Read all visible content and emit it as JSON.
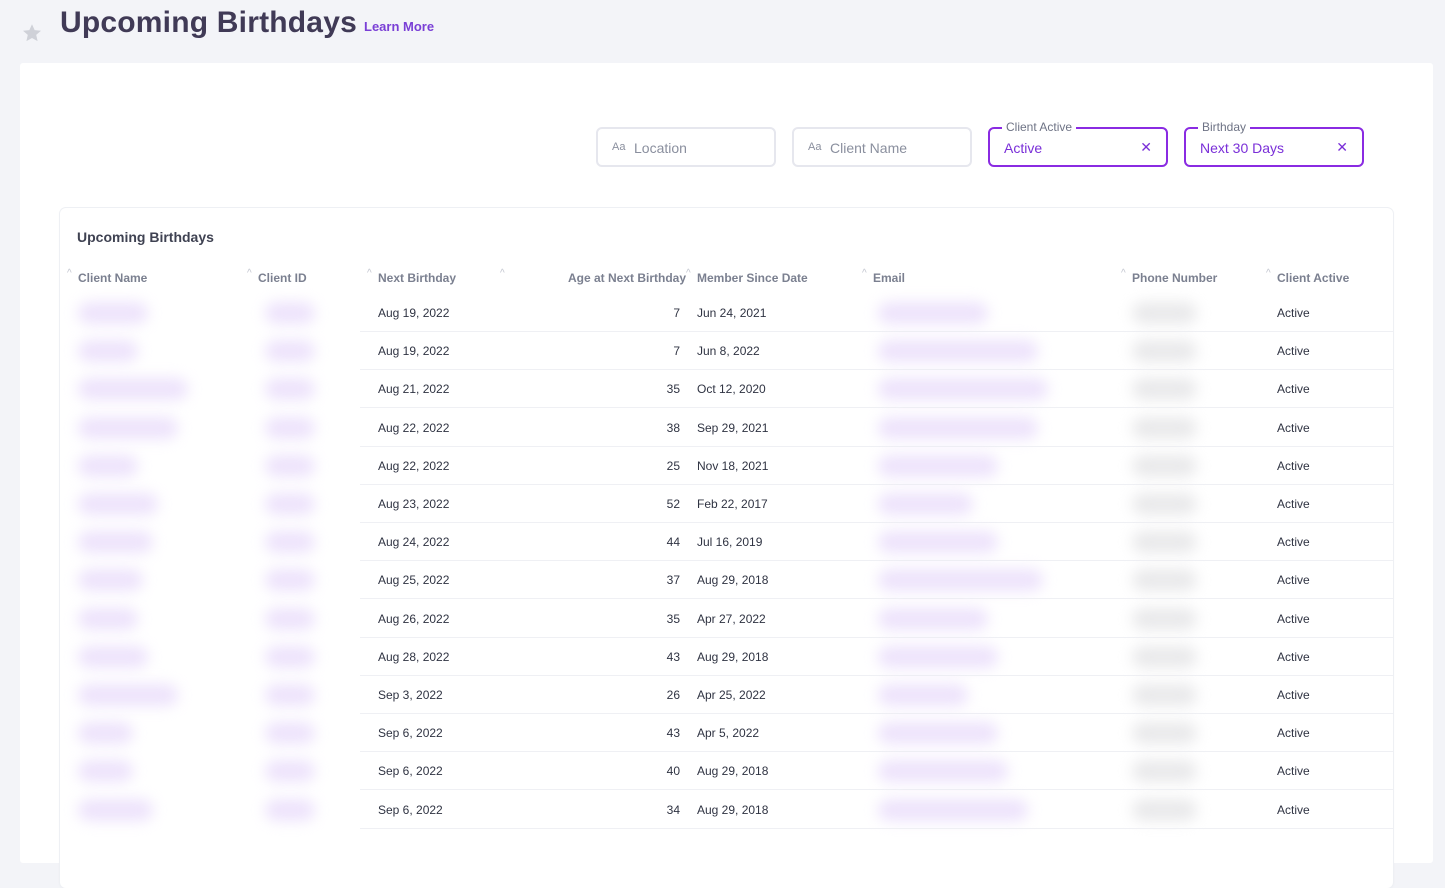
{
  "header": {
    "title": "Upcoming Birthdays",
    "learn_more": "Learn More",
    "favorite_icon": "star-icon"
  },
  "filters": {
    "location": {
      "prefix": "Aa",
      "placeholder": "Location"
    },
    "client_name": {
      "prefix": "Aa",
      "placeholder": "Client Name"
    },
    "client_active": {
      "label": "Client Active",
      "value": "Active",
      "clear": "✕"
    },
    "birthday": {
      "label": "Birthday",
      "value": "Next 30 Days",
      "clear": "✕"
    }
  },
  "table": {
    "title": "Upcoming Birthdays",
    "columns": [
      "Client Name",
      "Client ID",
      "Next Birthday",
      "Age at Next Birthday",
      "Member Since Date",
      "Email",
      "Phone Number",
      "Client Active"
    ],
    "rows": [
      {
        "next_birthday": "Aug 19, 2022",
        "age": "7",
        "member_since": "Jun 24, 2021",
        "active": "Active"
      },
      {
        "next_birthday": "Aug 19, 2022",
        "age": "7",
        "member_since": "Jun 8, 2022",
        "active": "Active"
      },
      {
        "next_birthday": "Aug 21, 2022",
        "age": "35",
        "member_since": "Oct 12, 2020",
        "active": "Active"
      },
      {
        "next_birthday": "Aug 22, 2022",
        "age": "38",
        "member_since": "Sep 29, 2021",
        "active": "Active"
      },
      {
        "next_birthday": "Aug 22, 2022",
        "age": "25",
        "member_since": "Nov 18, 2021",
        "active": "Active"
      },
      {
        "next_birthday": "Aug 23, 2022",
        "age": "52",
        "member_since": "Feb 22, 2017",
        "active": "Active"
      },
      {
        "next_birthday": "Aug 24, 2022",
        "age": "44",
        "member_since": "Jul 16, 2019",
        "active": "Active"
      },
      {
        "next_birthday": "Aug 25, 2022",
        "age": "37",
        "member_since": "Aug 29, 2018",
        "active": "Active"
      },
      {
        "next_birthday": "Aug 26, 2022",
        "age": "35",
        "member_since": "Apr 27, 2022",
        "active": "Active"
      },
      {
        "next_birthday": "Aug 28, 2022",
        "age": "43",
        "member_since": "Aug 29, 2018",
        "active": "Active"
      },
      {
        "next_birthday": "Sep 3, 2022",
        "age": "26",
        "member_since": "Apr 25, 2022",
        "active": "Active"
      },
      {
        "next_birthday": "Sep 6, 2022",
        "age": "43",
        "member_since": "Apr 5, 2022",
        "active": "Active"
      },
      {
        "next_birthday": "Sep 6, 2022",
        "age": "40",
        "member_since": "Aug 29, 2018",
        "active": "Active"
      },
      {
        "next_birthday": "Sep 6, 2022",
        "age": "34",
        "member_since": "Aug 29, 2018",
        "active": "Active"
      }
    ]
  }
}
